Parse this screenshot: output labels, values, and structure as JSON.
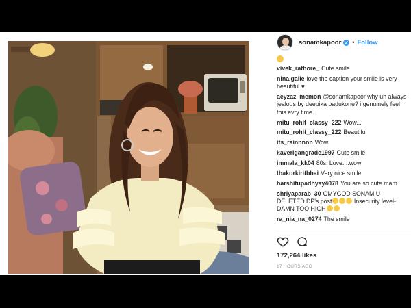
{
  "post": {
    "username": "sonamkapoor",
    "follow_label": "Follow",
    "separator": "•",
    "likes": "172,264 likes",
    "timestamp": "17 HOURS AGO"
  },
  "comments": [
    {
      "user": "vivek_rathore_",
      "text": "Cute smile"
    },
    {
      "user": "nina.galle",
      "text": "love the caption your smile is very beautiful ♥"
    },
    {
      "user": "aeyzaz_memon",
      "text": "@sonamkapoor why uh always jealous by deepika padukone? i genuinely feel this evry time."
    },
    {
      "user": "mitu_rohit_classy_222",
      "text": "Wow..."
    },
    {
      "user": "mitu_rohit_classy_222",
      "text": "Beautiful"
    },
    {
      "user": "its_rainnnnn",
      "text": "Wow"
    },
    {
      "user": "kaverigangrade1997",
      "text": "Cute smile"
    },
    {
      "user": "immala_kk04",
      "text": "80s. Love....wow"
    },
    {
      "user": "thakorkiritbhai",
      "text": "Very nice smile"
    },
    {
      "user": "harshitupadhyay4078",
      "text": "You are so cute mam"
    },
    {
      "user": "shriyaparab_30",
      "text": "OMYGOD SONAM U DELETED DP's post",
      "emojis": 3,
      "text2": " Insecurity level- DAMN TOO HIGH",
      "emojis2": 2
    },
    {
      "user": "ra_nia_na_0274",
      "text": "The smile"
    }
  ],
  "icons": {
    "like": "heart-icon",
    "comment": "comment-icon",
    "verified": "verified-badge-icon"
  },
  "colors": {
    "link": "#3897f0",
    "text": "#262626",
    "muted": "#999999"
  }
}
